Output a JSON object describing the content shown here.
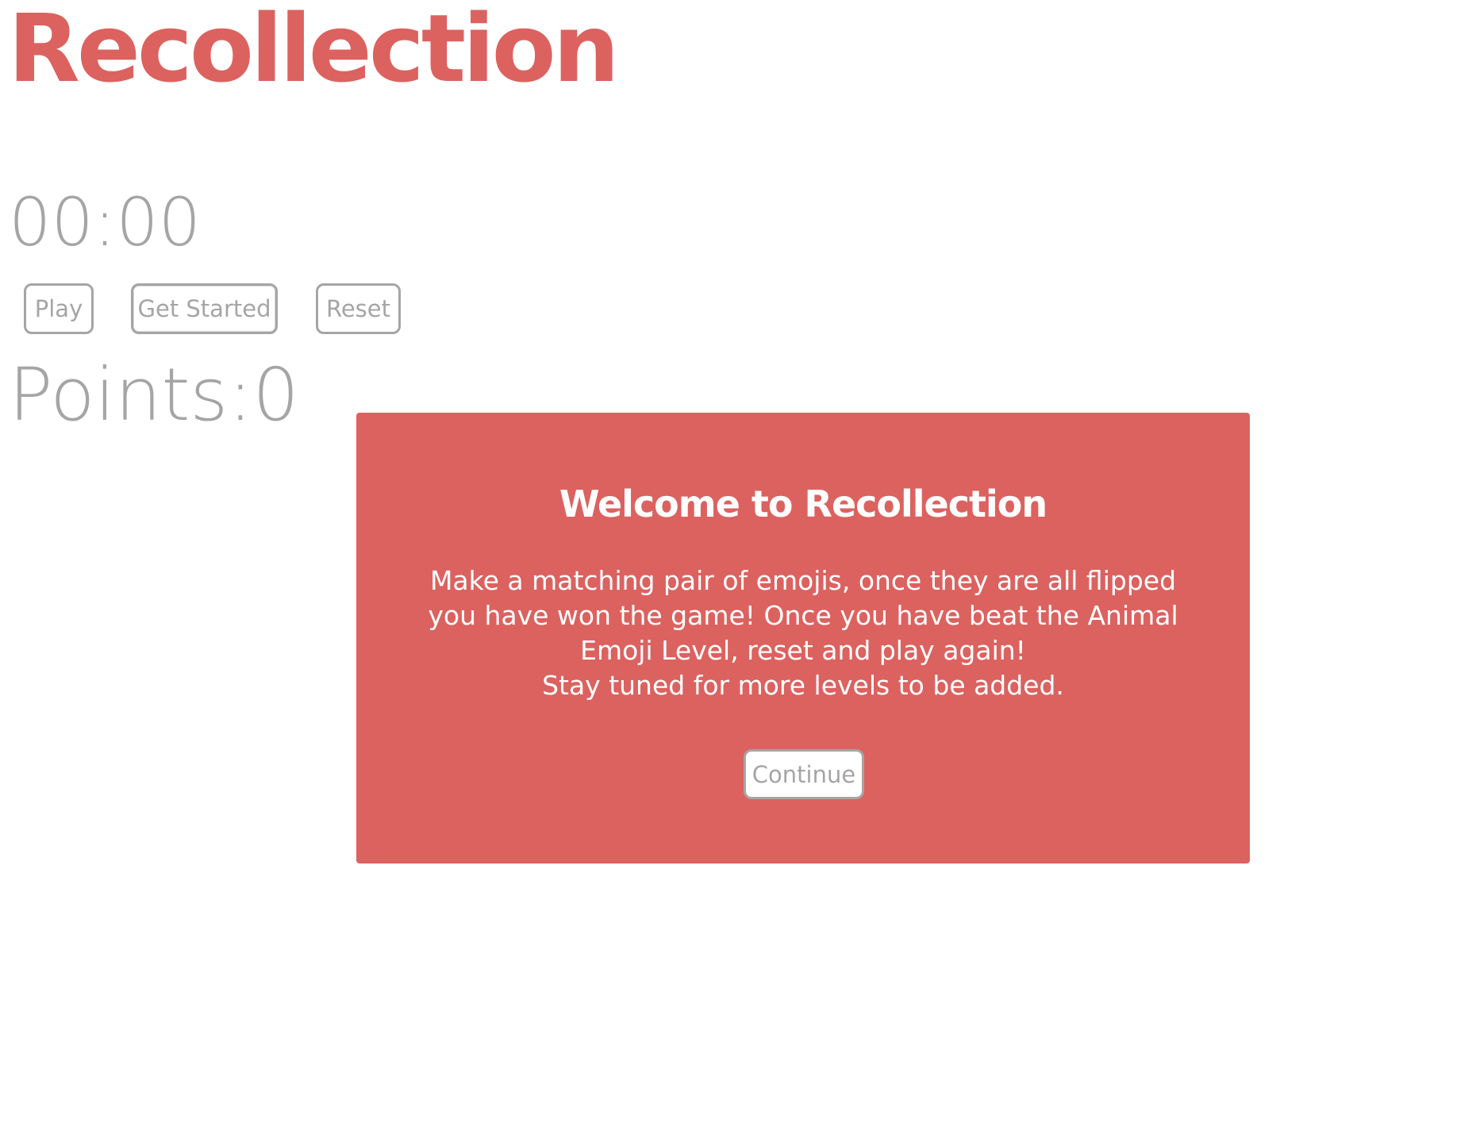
{
  "app": {
    "title": "Recollection"
  },
  "game": {
    "timer": "00:00",
    "points_label": "Points:",
    "points_value": "0"
  },
  "controls": {
    "play_label": "Play",
    "get_started_label": "Get Started",
    "reset_label": "Reset"
  },
  "modal": {
    "title": "Welcome to Recollection",
    "body_line_1": "Make a matching pair of emojis, once they are all flipped you have won the game! Once you have beat the Animal Emoji Level, reset and play again!",
    "body_line_2": "Stay tuned for more levels to be added.",
    "continue_label": "Continue"
  },
  "colors": {
    "accent": "#dc625f",
    "muted_text": "#a5a5a5",
    "background": "#ffffff"
  }
}
